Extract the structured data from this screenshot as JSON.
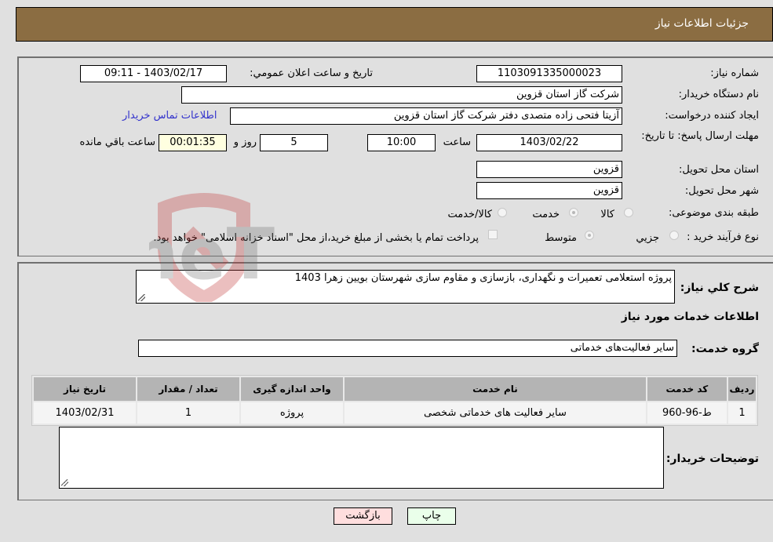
{
  "header": {
    "title": "جزئیات اطلاعات نیاز"
  },
  "form": {
    "need_number": {
      "label": "شماره نیاز:",
      "value": "1103091335000023"
    },
    "announce_datetime": {
      "label": "تاریخ و ساعت اعلان عمومي:",
      "value": "1403/02/17 - 09:11"
    },
    "buyer_org": {
      "label": "نام دستگاه خریدار:",
      "value": "شرکت گاز استان قزوین"
    },
    "requester": {
      "label": "ایجاد کننده درخواست:",
      "value": "آزیتا فتحی زاده متصدی دفتر شرکت گاز استان قزوین",
      "contact_link": "اطلاعات تماس خریدار"
    },
    "deadline": {
      "label": "مهلت ارسال پاسخ: تا تاریخ:",
      "date": "1403/02/22",
      "time_label": "ساعت",
      "time": "10:00",
      "days": "5",
      "days_label": "روز و",
      "remaining": "00:01:35",
      "remaining_label": "ساعت باقي مانده"
    },
    "delivery_province": {
      "label": "استان محل تحویل:",
      "value": "قزوین"
    },
    "delivery_city": {
      "label": "شهر محل تحویل:",
      "value": "قزوین"
    },
    "category": {
      "label": "طبقه بندی موضوعی:",
      "options": [
        "کالا",
        "خدمت",
        "کالا/خدمت"
      ],
      "selected": "خدمت"
    },
    "purchase_process": {
      "label": "نوع فرآیند خرید :",
      "options": [
        "جزيي",
        "متوسط"
      ],
      "selected": "متوسط",
      "treasury_checkbox_label": "پرداخت تمام یا بخشی از مبلغ خرید،از محل \"اسناد خزانه اسلامی\" خواهد بود.",
      "treasury_checked": false
    }
  },
  "details": {
    "description_label": "شرح کلي نیاز:",
    "description_value": "پروژه استعلامی تعمیرات و نگهداری، بازسازی و مقاوم سازی شهرستان بویین زهرا 1403",
    "services_heading": "اطلاعات خدمات مورد نیاز",
    "service_group_label": "گروه خدمت:",
    "service_group_value": "سایر فعالیت‌های خدماتی",
    "table": {
      "headers": [
        "ردیف",
        "کد خدمت",
        "نام خدمت",
        "واحد اندازه گیری",
        "تعداد / مقدار",
        "تاریخ نیاز"
      ],
      "rows": [
        [
          "1",
          "ط-96-960",
          "سایر فعالیت های خدماتی شخصی",
          "پروژه",
          "1",
          "1403/02/31"
        ]
      ]
    },
    "buyer_notes_label": "توضیحات خریدار:",
    "buyer_notes_value": ""
  },
  "buttons": {
    "print": "چاپ",
    "back": "بازگشت"
  },
  "colors": {
    "header_bg": "#8b6d42",
    "print_bg": "#eaffea",
    "back_bg": "#ffdede",
    "link": "#3333cc"
  }
}
